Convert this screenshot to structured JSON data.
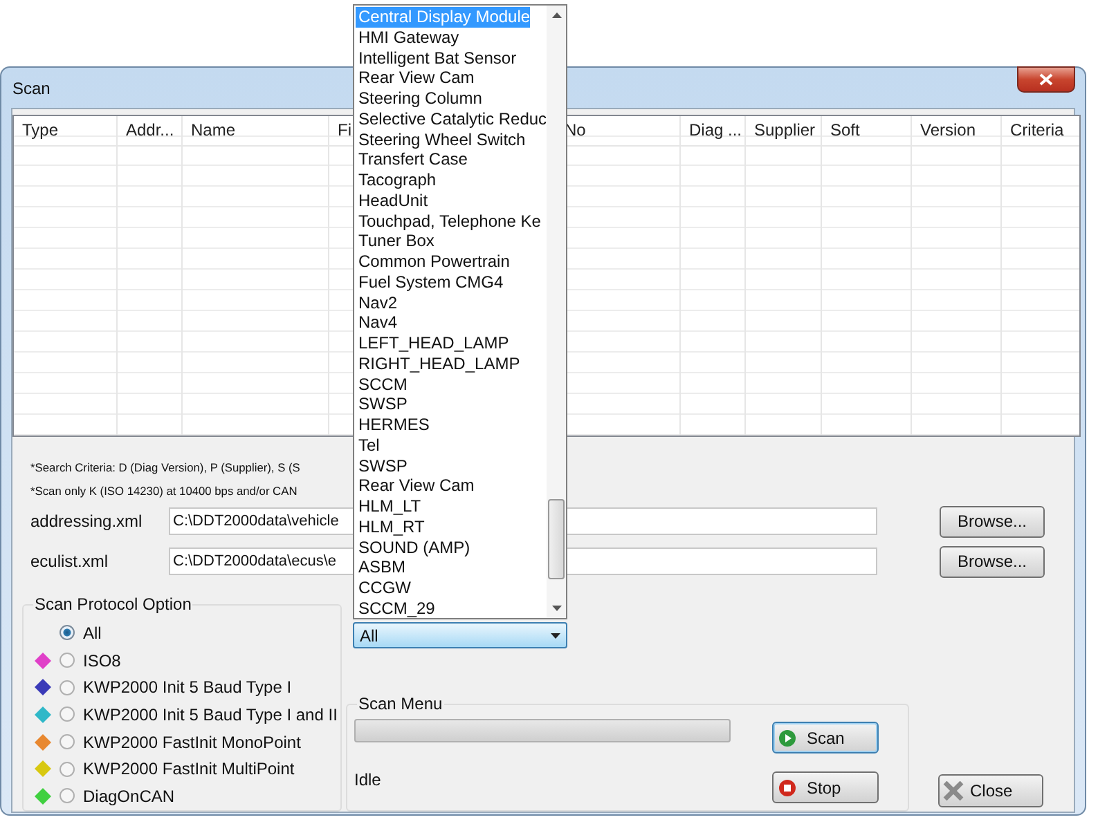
{
  "window": {
    "title": "Scan"
  },
  "table": {
    "columns": [
      "Type",
      "Addr...",
      "Name",
      "Fi",
      "No",
      "Diag ...",
      "Supplier",
      "Soft",
      "Version",
      "Criteria"
    ]
  },
  "notes": [
    "*Search Criteria: D (Diag Version), P (Supplier), S (S",
    "*Scan only K (ISO 14230) at 10400 bps and/or CAN"
  ],
  "files": [
    {
      "label": "addressing.xml",
      "value": "C:\\DDT2000data\\vehicle",
      "button": "Browse..."
    },
    {
      "label": "eculist.xml",
      "value": "C:\\DDT2000data\\ecus\\e",
      "button": "Browse..."
    }
  ],
  "protocol_group": {
    "title": "Scan Protocol Option",
    "options": [
      {
        "label": "All",
        "selected": true
      },
      {
        "label": "ISO8",
        "selected": false,
        "color": "#e040c8"
      },
      {
        "label": "KWP2000 Init 5 Baud Type I",
        "selected": false,
        "color": "#3a3ab8"
      },
      {
        "label": "KWP2000 Init 5 Baud Type I and II",
        "selected": false,
        "color": "#30b8c8"
      },
      {
        "label": "KWP2000 FastInit MonoPoint",
        "selected": false,
        "color": "#e88830"
      },
      {
        "label": "KWP2000 FastInit MultiPoint",
        "selected": false,
        "color": "#d8c810"
      },
      {
        "label": "DiagOnCAN",
        "selected": false,
        "color": "#40d040"
      }
    ]
  },
  "ecu_combo": {
    "value": "All",
    "list": [
      {
        "label": "Central Display Module",
        "selected": true
      },
      {
        "label": "HMI Gateway",
        "selected": false
      },
      {
        "label": "Intelligent Bat Sensor",
        "selected": false
      },
      {
        "label": "Rear View Cam",
        "selected": false
      },
      {
        "label": "Steering Column",
        "selected": false
      },
      {
        "label": "Selective Catalytic Reduc",
        "selected": false
      },
      {
        "label": "Steering Wheel Switch",
        "selected": false
      },
      {
        "label": "Transfert Case",
        "selected": false
      },
      {
        "label": "Tacograph",
        "selected": false
      },
      {
        "label": "HeadUnit",
        "selected": false
      },
      {
        "label": "Touchpad, Telephone Ke",
        "selected": false
      },
      {
        "label": "Tuner Box",
        "selected": false
      },
      {
        "label": "Common Powertrain",
        "selected": false
      },
      {
        "label": "Fuel System CMG4",
        "selected": false
      },
      {
        "label": "Nav2",
        "selected": false
      },
      {
        "label": "Nav4",
        "selected": false
      },
      {
        "label": "LEFT_HEAD_LAMP",
        "selected": false
      },
      {
        "label": "RIGHT_HEAD_LAMP",
        "selected": false
      },
      {
        "label": "SCCM",
        "selected": false
      },
      {
        "label": "SWSP",
        "selected": false
      },
      {
        "label": "HERMES",
        "selected": false
      },
      {
        "label": "Tel",
        "selected": false
      },
      {
        "label": "SWSP",
        "selected": false
      },
      {
        "label": "Rear View Cam",
        "selected": false
      },
      {
        "label": "HLM_LT",
        "selected": false
      },
      {
        "label": "HLM_RT",
        "selected": false
      },
      {
        "label": "SOUND (AMP)",
        "selected": false
      },
      {
        "label": "ASBM",
        "selected": false
      },
      {
        "label": "CCGW",
        "selected": false
      },
      {
        "label": "SCCM_29",
        "selected": false
      }
    ]
  },
  "scan_menu": {
    "title": "Scan Menu",
    "progress": {
      "level": 0
    },
    "status": "Idle",
    "buttons": [
      {
        "kind": "scan",
        "label": "Scan"
      },
      {
        "kind": "stop",
        "label": "Stop"
      }
    ]
  },
  "close_button": {
    "label": "Close"
  }
}
